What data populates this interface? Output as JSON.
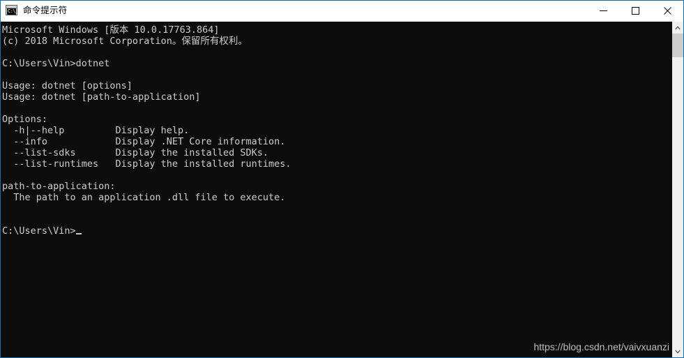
{
  "window": {
    "title": "命令提示符",
    "icon": "cmd-console-icon",
    "icon_prompt_text": "C:\\_",
    "border_color": "#1e6ba1",
    "titlebar_bg": "#ffffff",
    "controls": {
      "minimize_label": "最小化",
      "maximize_label": "最大化",
      "close_label": "关闭"
    }
  },
  "console": {
    "background_color": "#0c0c0c",
    "text_color": "#cccccc",
    "lines": [
      "Microsoft Windows [版本 10.0.17763.864]",
      "(c) 2018 Microsoft Corporation。保留所有权利。",
      "",
      "C:\\Users\\Vin>dotnet",
      "",
      "Usage: dotnet [options]",
      "Usage: dotnet [path-to-application]",
      "",
      "Options:",
      "  -h|--help         Display help.",
      "  --info            Display .NET Core information.",
      "  --list-sdks       Display the installed SDKs.",
      "  --list-runtimes   Display the installed runtimes.",
      "",
      "path-to-application:",
      "  The path to an application .dll file to execute.",
      "",
      ""
    ],
    "prompt": "C:\\Users\\Vin>",
    "cursor": "_"
  },
  "watermark": {
    "text": "https://blog.csdn.net/vaivxuanzi"
  },
  "scrollbar": {
    "up_arrow": "▲",
    "down_arrow": "▼",
    "track_color": "#f0f0f0",
    "thumb_color": "#cdcdcd"
  }
}
